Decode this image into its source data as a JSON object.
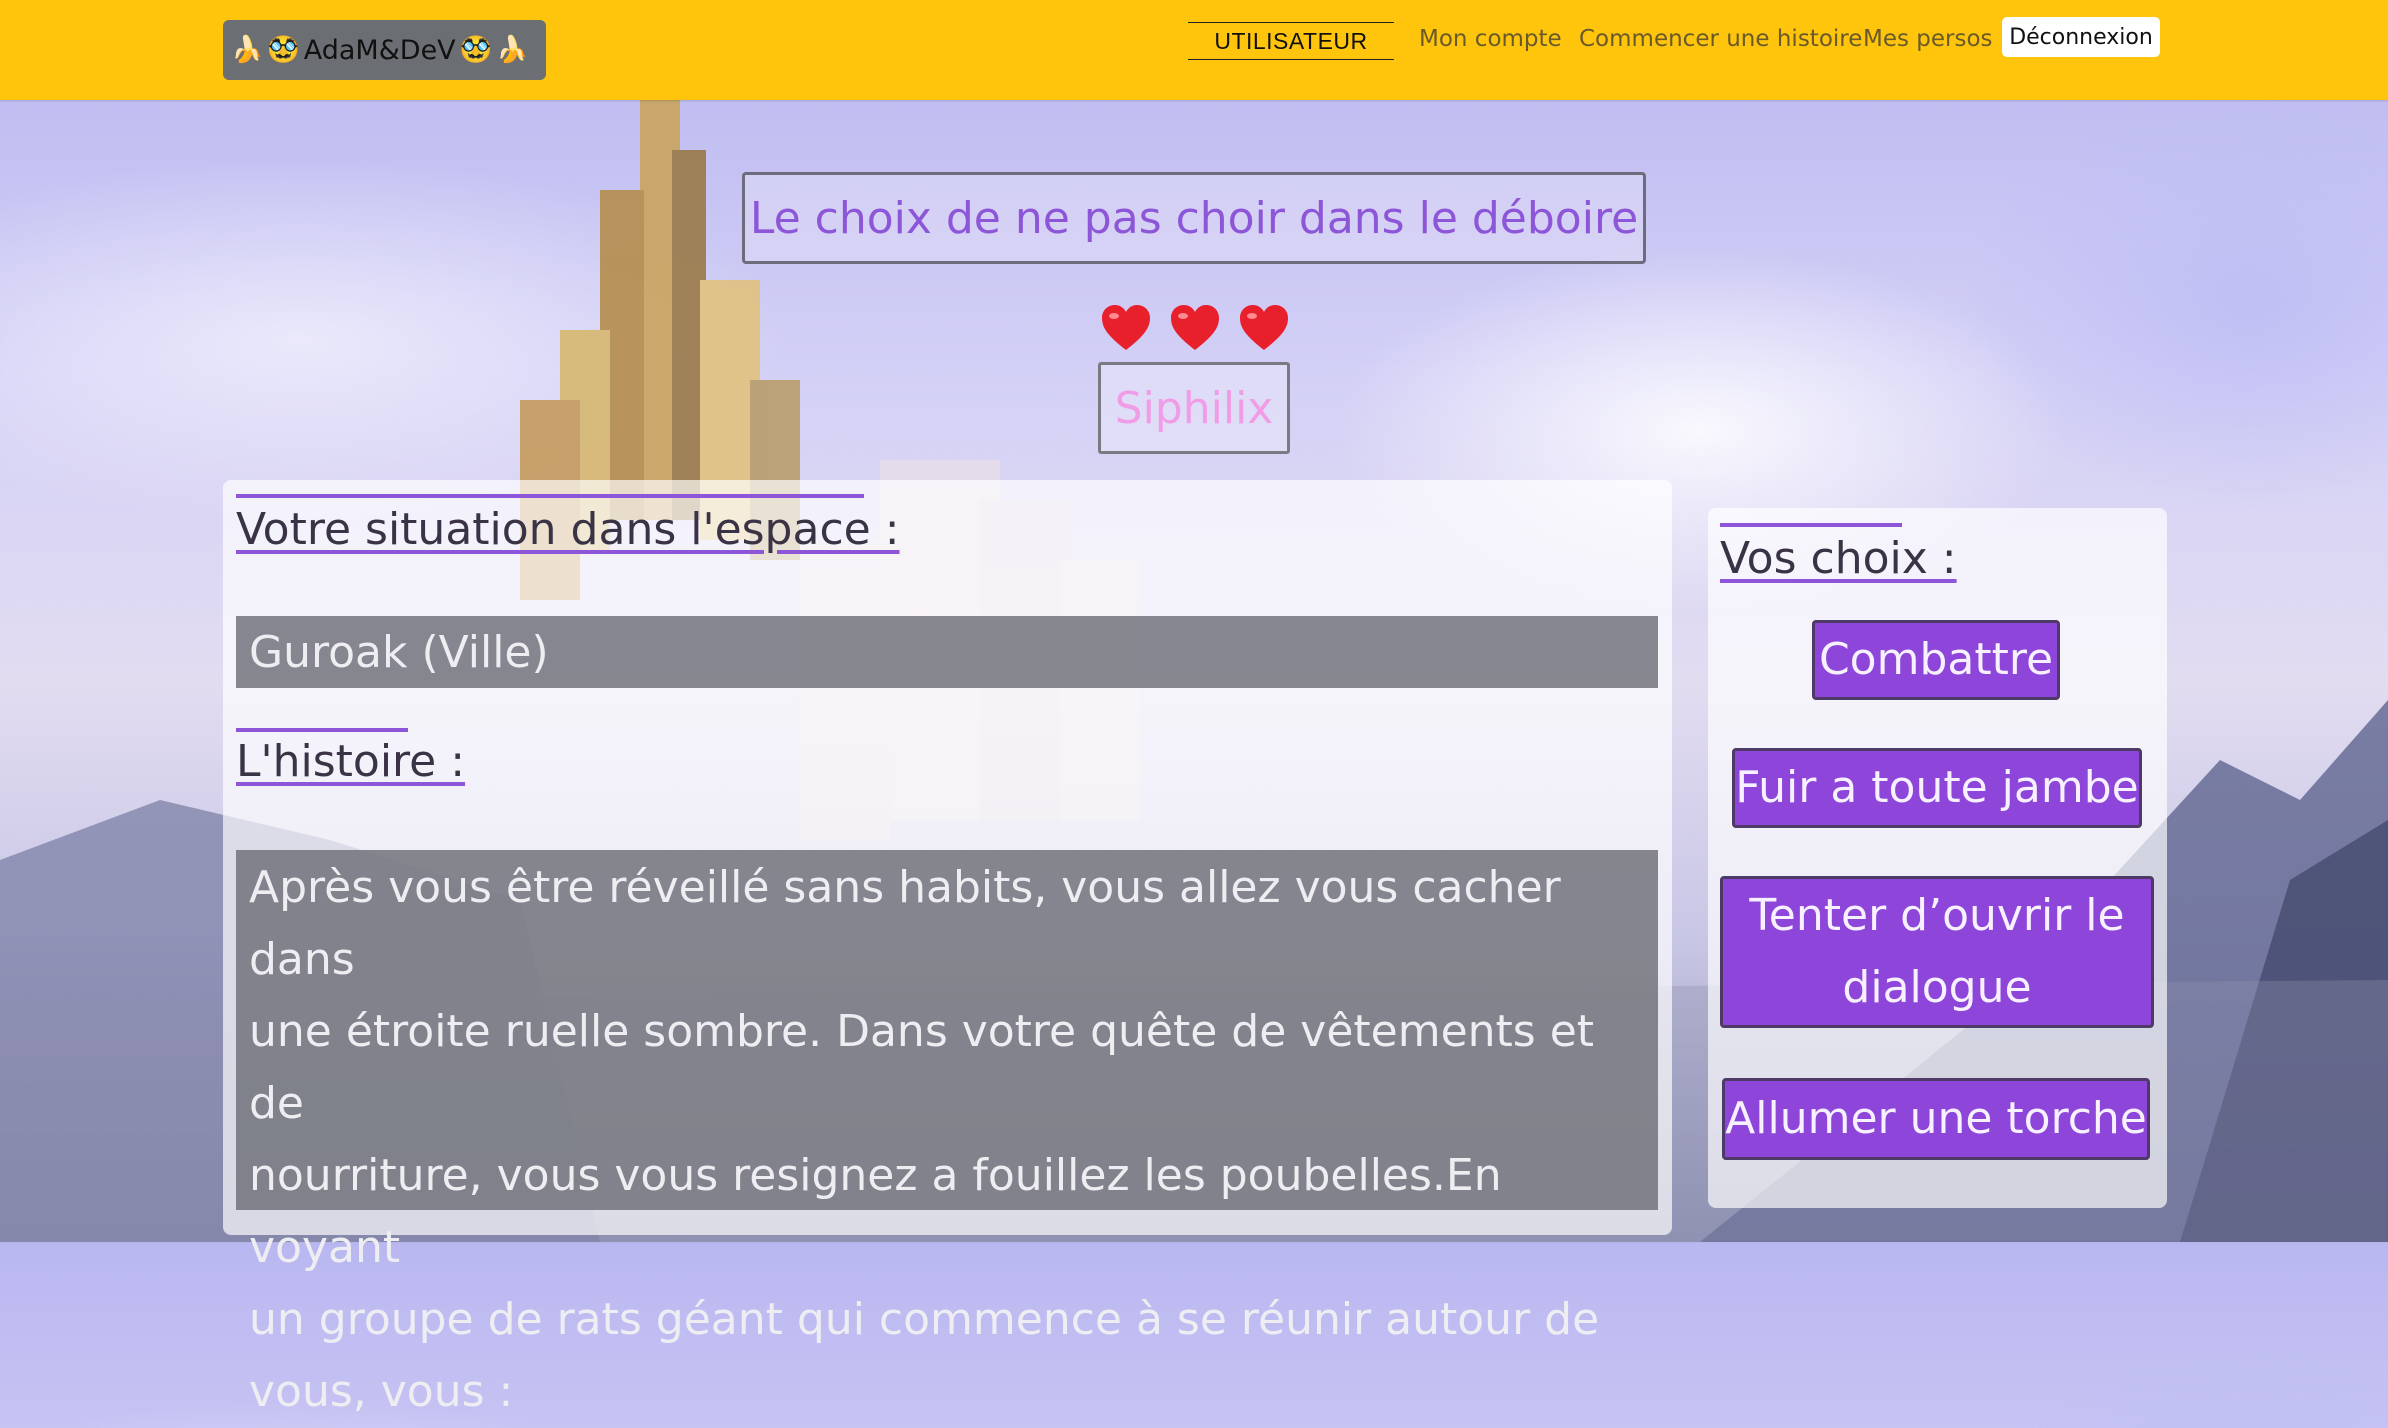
{
  "navbar": {
    "brand": {
      "banana": "🍌",
      "face": "🥸",
      "name": "AdaM&DeV"
    },
    "user_label": "UTILISATEUR",
    "links": [
      "Mon compte",
      "Commencer une histoire",
      "Mes persos"
    ],
    "logout_label": "Déconnexion"
  },
  "story": {
    "title": "Le choix de ne pas choir dans le déboire"
  },
  "character": {
    "name": "Siphilix",
    "lives": 3
  },
  "situation": {
    "heading": "Votre situation dans l'espace :",
    "location": "Guroak (Ville)"
  },
  "history": {
    "heading": "L'histoire :",
    "lines": [
      "Après vous être réveillé sans habits, vous allez vous cacher dans",
      "une étroite ruelle sombre. Dans votre quête de vêtements et de",
      "nourriture, vous vous resignez a fouillez les poubelles.En voyant",
      "un groupe de rats géant qui commence à se réunir autour de",
      "vous, vous :"
    ]
  },
  "choices": {
    "heading": "Vos choix :",
    "options": [
      {
        "lines": [
          "Combattre"
        ]
      },
      {
        "lines": [
          "Fuir a toute jambe"
        ]
      },
      {
        "lines": [
          "Tenter d’ouvrir le",
          "dialogue"
        ]
      },
      {
        "lines": [
          "Allumer une torche"
        ]
      }
    ]
  },
  "colors": {
    "navbar": "#ffc40c",
    "accent": "#8d56d8",
    "button": "#8d46d9",
    "character": "#f09ce6"
  }
}
